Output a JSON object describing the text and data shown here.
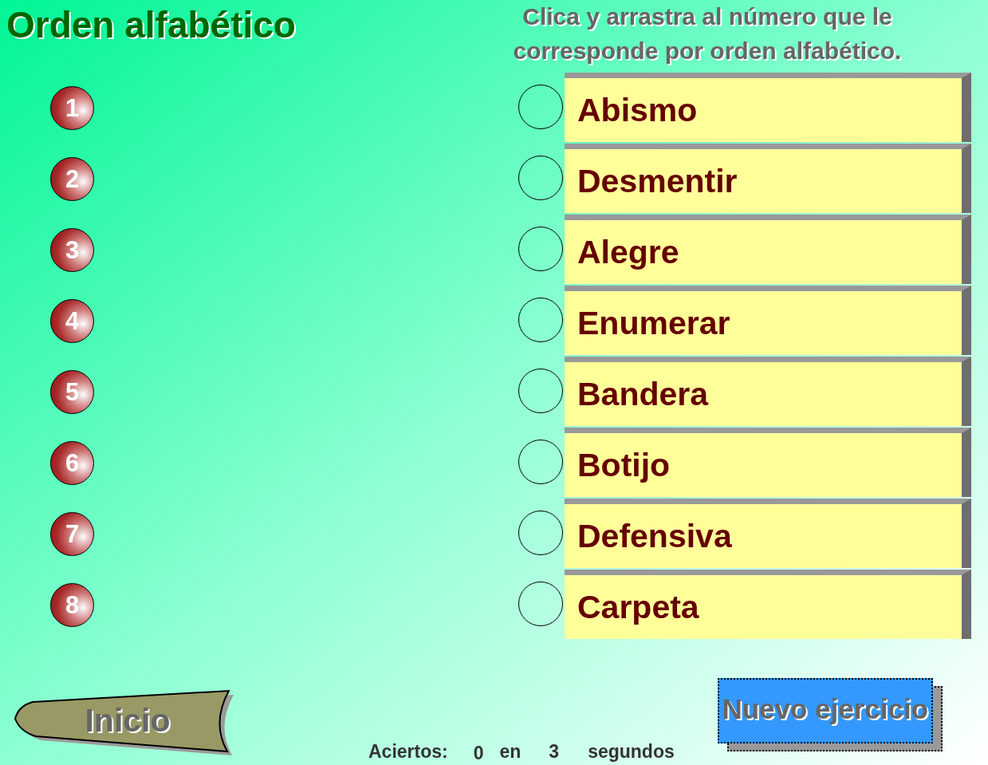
{
  "title": "Orden alfabético",
  "instruction": "Clica y arrastra al número que le corresponde por orden alfabético.",
  "numbers": [
    "1",
    "2",
    "3",
    "4",
    "5",
    "6",
    "7",
    "8"
  ],
  "words": [
    "Abismo",
    "Desmentir",
    "Alegre",
    "Enumerar",
    "Bandera",
    "Botijo",
    "Defensiva",
    "Carpeta"
  ],
  "home_button": {
    "label": "Inicio"
  },
  "score": {
    "label": "Aciertos:",
    "hits": "0",
    "connector": "en",
    "seconds": "3",
    "unit": "segundos"
  },
  "new_exercise_button": {
    "label": "Nuevo ejercicio"
  }
}
